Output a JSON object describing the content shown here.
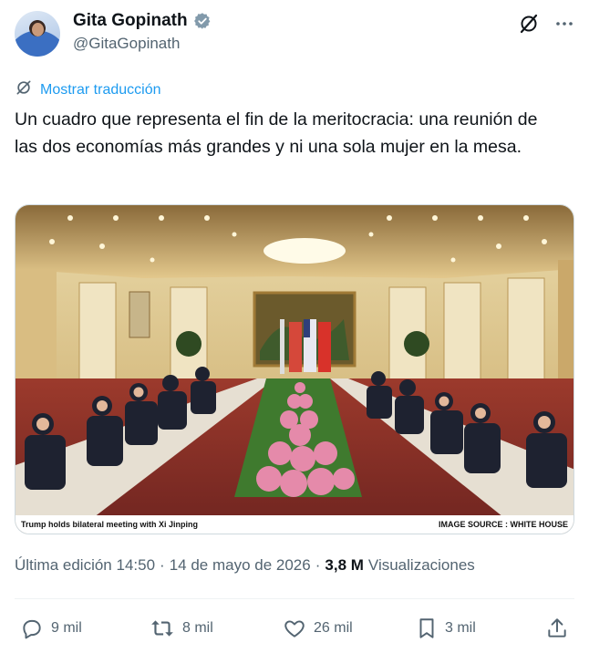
{
  "author": {
    "display_name": "Gita Gopinath",
    "handle": "@GitaGopinath"
  },
  "translate_label": "Mostrar traducción",
  "tweet_text": "Un cuadro que representa el fin de la meritocracia: una reunión de las dos economías más grandes y ni una sola mujer en la mesa.",
  "media": {
    "caption_left": "Trump holds bilateral meeting with Xi Jinping",
    "caption_right": "IMAGE SOURCE : WHITE HOUSE"
  },
  "meta": {
    "edited": "Última edición 14:50",
    "dot1": "·",
    "date": "14 de mayo de 2026",
    "dot2": "·",
    "views_count": "3,8 M",
    "views_label": "Visualizaciones"
  },
  "actions": {
    "replies": "9 mil",
    "reposts": "8 mil",
    "likes": "26 mil",
    "bookmarks": "3 mil"
  },
  "colors": {
    "accent": "#1d9bf0",
    "secondary_text": "#536471",
    "primary_text": "#0f1419"
  }
}
